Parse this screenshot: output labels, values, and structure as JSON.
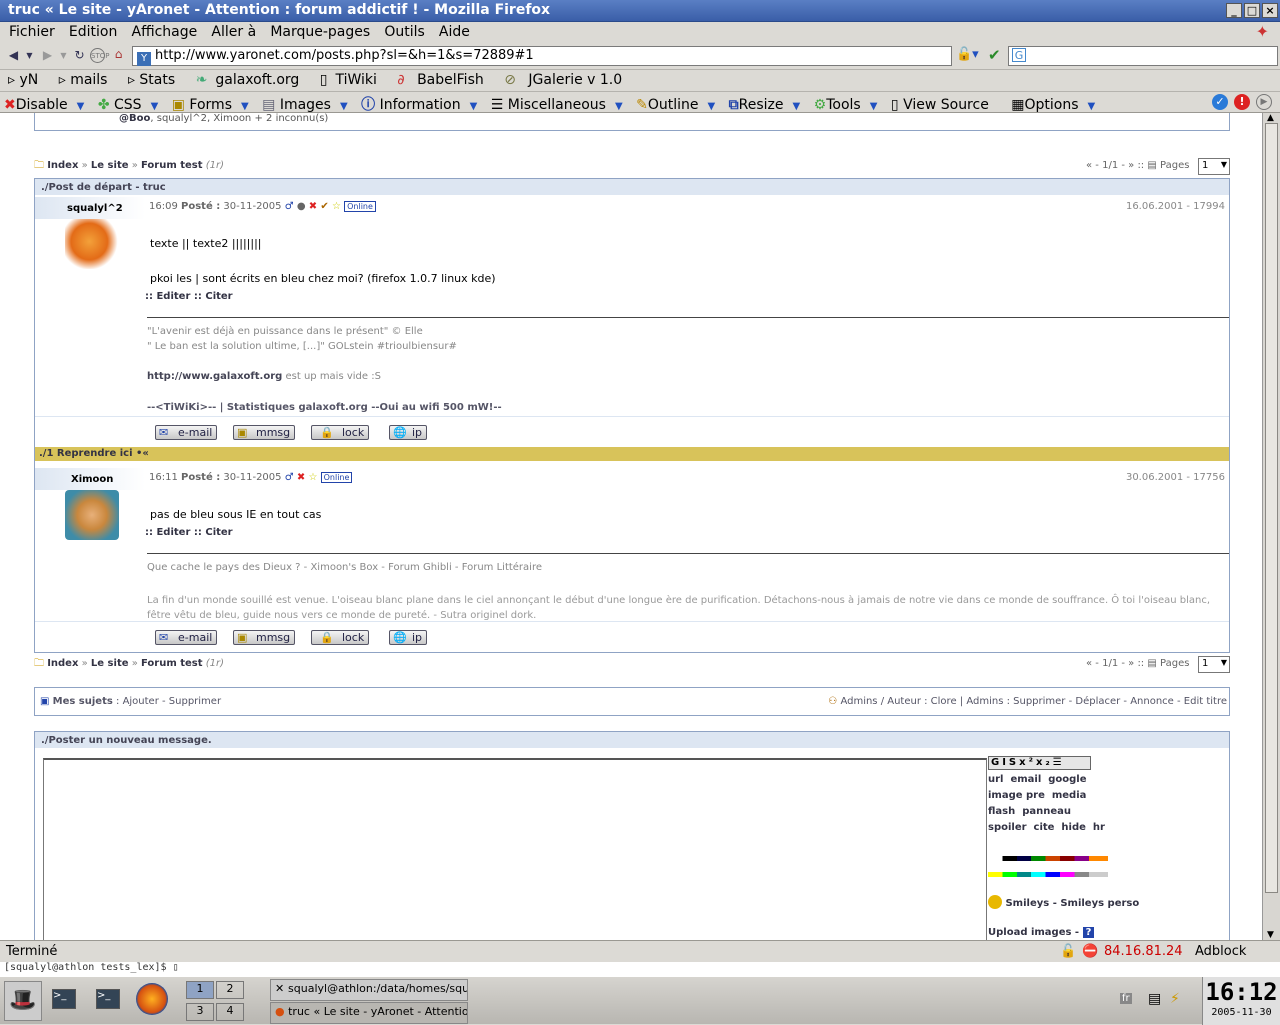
{
  "window": {
    "title": "truc « Le site - yAronet - Attention : forum addictif ! - Mozilla Firefox"
  },
  "menu": [
    "Fichier",
    "Edition",
    "Affichage",
    "Aller à",
    "Marque-pages",
    "Outils",
    "Aide"
  ],
  "url": "http://www.yaronet.com/posts.php?sl=&h=1&s=72889#1",
  "bookmarks": [
    "yN",
    "mails",
    "Stats",
    "galaxoft.org",
    "TiWiki",
    "BabelFish",
    "JGalerie v 1.0"
  ],
  "devtools": [
    "Disable",
    "CSS",
    "Forms",
    "Images",
    "Information",
    "Miscellaneous",
    "Outline",
    "Resize",
    "Tools",
    "View Source",
    "Options"
  ],
  "page": {
    "online_users_prefix": "@Boo",
    "online_users_rest": ", squalyl^2, Ximoon",
    "online_unknown": "+ 2 inconnu(s)",
    "breadcrumb": {
      "index": "Index",
      "site": "Le site",
      "forum": "Forum test",
      "count": "(1r)",
      "sep": "»"
    },
    "pager": {
      "text": "« - 1/1 - » ::",
      "label": "Pages",
      "value": "1"
    },
    "thread_header": "./Post de départ - truc",
    "posts": [
      {
        "author": "squalyl^2",
        "time": "16:09",
        "posted_label": "Posté :",
        "date": "30-11-2005",
        "status": "Online",
        "right_meta": "16.06.2001 - 17994",
        "body": [
          "texte || texte2 ||||||||",
          "pkoi les | sont écrits en bleu chez moi? (firefox 1.0.7 linux kde)"
        ],
        "actions": ":: Editer  :: Citer",
        "sig": [
          "\"L'avenir est déjà en puissance dans le présent\" © Elle",
          "\" Le ban est la solution ultime, [...]\" GOLstein #trioulbiensur#",
          "http://www.galaxoft.org",
          " est up mais vide :S",
          "--<TiWiKi>-- | Statistiques galaxoft.org --Oui au wifi 500 mW!--"
        ]
      },
      {
        "author": "Ximoon",
        "time": "16:11",
        "posted_label": "Posté :",
        "date": "30-11-2005",
        "status": "Online",
        "right_meta": "30.06.2001 - 17756",
        "body": [
          "pas de bleu sous IE en tout cas"
        ],
        "actions": ":: Editer  :: Citer",
        "sig": [
          "Que cache le pays des Dieux ? - Ximoon's Box - Forum Ghibli - Forum Littéraire",
          "La fin d'un monde souillé est venue. L'oiseau blanc plane dans le ciel annonçant le début d'une longue ère de purification. Détachons-nous à jamais de notre vie dans ce monde de souffrance. Ô toi l'oiseau blanc, fêtre vêtu de bleu, guide nous vers ce monde de pureté. - Sutra originel dork."
        ]
      }
    ],
    "reply_marker": "./1   Reprendre ici •«",
    "buttons": [
      "e-mail",
      "mmsg",
      "lock",
      "ip"
    ],
    "my_topics": {
      "label": "Mes sujets",
      "text": ": Ajouter - Supprimer"
    },
    "admin_text": "Admins / Auteur : Clore | Admins : Supprimer - Déplacer - Annonce - Edit titre",
    "new_message_header": "./Poster un nouveau message.",
    "bbcode": [
      "url",
      "email",
      "google",
      "image pre",
      "media",
      "flash",
      "panneau",
      "spoiler",
      "cite",
      "hide",
      "hr"
    ],
    "smileys": "Smileys - Smileys perso",
    "upload": "Upload images -"
  },
  "status": {
    "left": "Terminé",
    "ip": "84.16.81.24",
    "adblock": "Adblock"
  },
  "terminal_line": "[squalyl@athlon tests_lex]$ ▯",
  "taskbar": {
    "desktops": [
      "1",
      "2",
      "3",
      "4"
    ],
    "task1": "squalyl@athlon:/data/homes/squaly",
    "task2": "truc « Le site - yAronet - Attentio",
    "clock": "16:12",
    "date": "2005-11-30"
  },
  "colors": {
    "accent": "#8fa3c4",
    "gold_bar": "#d8c35a",
    "titlebar": "#3a5ea8"
  }
}
